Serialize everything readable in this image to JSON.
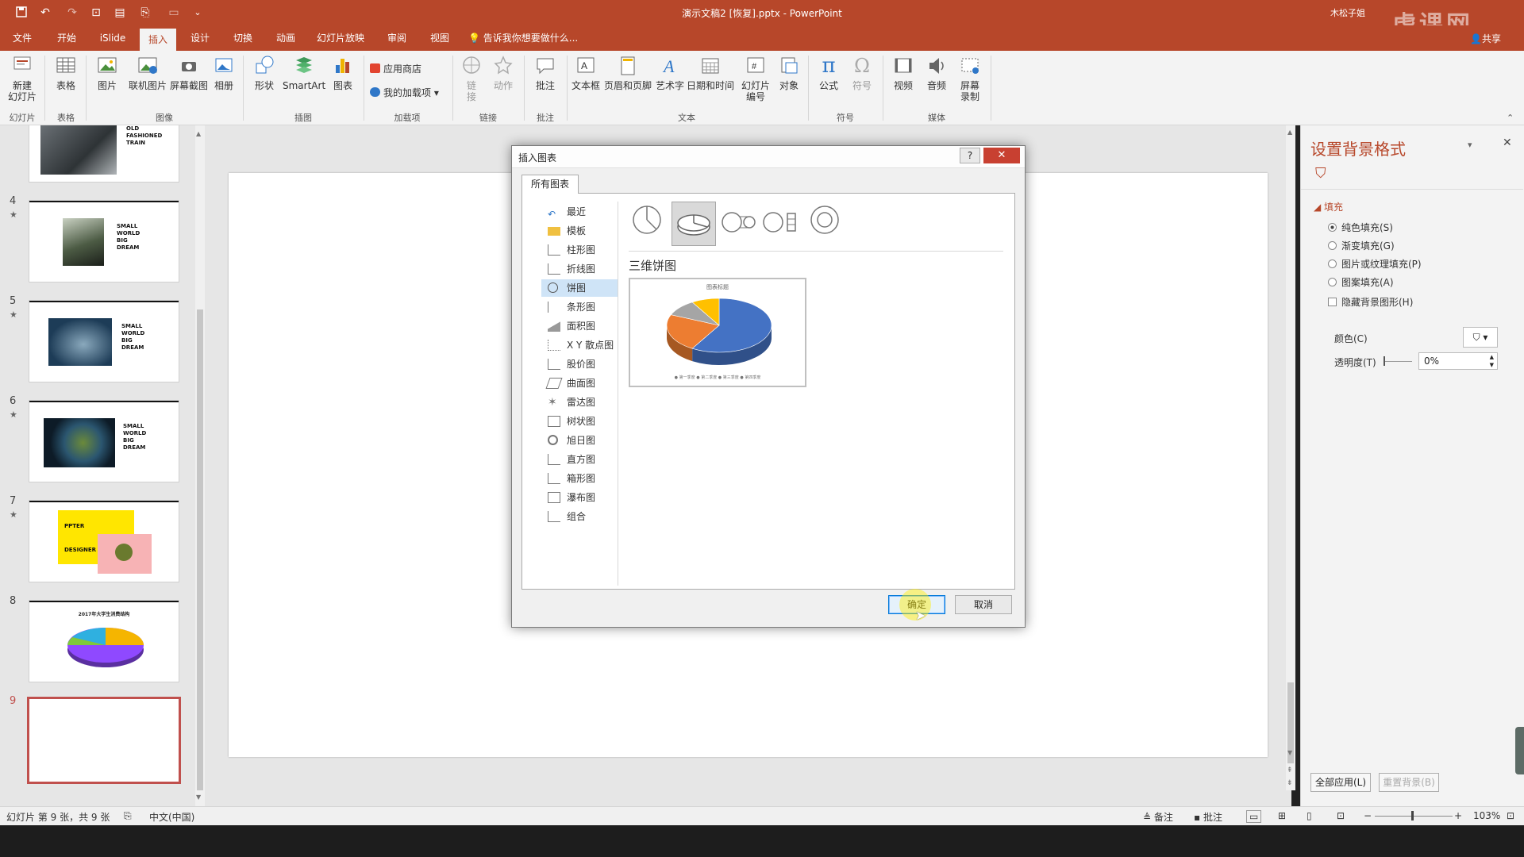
{
  "window": {
    "title": "演示文稿2 [恢复].pptx  -  PowerPoint",
    "user": "木松子姐",
    "share": "共享",
    "watermark": "虎课网"
  },
  "tabs": [
    "文件",
    "开始",
    "iSlide",
    "插入",
    "设计",
    "切换",
    "动画",
    "幻灯片放映",
    "审阅",
    "视图"
  ],
  "active_tab": "插入",
  "tell_me": "告诉我你想要做什么...",
  "ribbon": {
    "new_slide": [
      "新建",
      "幻灯片"
    ],
    "table": "表格",
    "picture": "图片",
    "online_picture": "联机图片",
    "screenshot": "屏幕截图",
    "album": "相册",
    "shapes": "形状",
    "smartart": "SmartArt",
    "chart": "图表",
    "store": "应用商店",
    "my_addins": "我的加载项",
    "link": [
      "链",
      "接"
    ],
    "action": "动作",
    "comment": "批注",
    "textbox": "文本框",
    "header_footer": "页眉和页脚",
    "wordart": "艺术字",
    "datetime": "日期和时间",
    "slide_number": [
      "幻灯片",
      "编号"
    ],
    "object": "对象",
    "equation": "公式",
    "symbol": "符号",
    "video": "视频",
    "audio": "音频",
    "screen_record": [
      "屏幕",
      "录制"
    ],
    "groups": {
      "slides": "幻灯片",
      "tables": "表格",
      "images": "图像",
      "illustrations": "插图",
      "addins": "加载项",
      "links": "链接",
      "comments": "批注",
      "text": "文本",
      "symbols": "符号",
      "media": "媒体"
    }
  },
  "thumbnails": {
    "items": [
      {
        "num": "4",
        "star": "★",
        "lines": [
          "SMALL",
          "WORLD",
          "BIG",
          "DREAM"
        ]
      },
      {
        "num": "5",
        "star": "★",
        "lines": [
          "SMALL",
          "WORLD",
          "BIG",
          "DREAM"
        ]
      },
      {
        "num": "6",
        "star": "★",
        "lines": [
          "SMALL",
          "WORLD",
          "BIG",
          "DREAM"
        ]
      },
      {
        "num": "7",
        "star": "★",
        "lines": [
          "PPTER",
          "DESIGNER"
        ]
      },
      {
        "num": "8",
        "title": "2017年大学生消费结构"
      },
      {
        "num": "9"
      }
    ],
    "top_lines": [
      "OLD",
      "FASHIONED",
      "TRAIN"
    ]
  },
  "dialog": {
    "title": "插入图表",
    "help": "?",
    "tab": "所有图表",
    "chart_types": [
      "最近",
      "模板",
      "柱形图",
      "折线图",
      "饼图",
      "条形图",
      "面积图",
      "X Y 散点图",
      "股价图",
      "曲面图",
      "雷达图",
      "树状图",
      "旭日图",
      "直方图",
      "箱形图",
      "瀑布图",
      "组合"
    ],
    "selected_type": "饼图",
    "selected_subtype": "三维饼图",
    "preview_title": "图表标题",
    "preview_legend": [
      "第一季度",
      "第二季度",
      "第三季度",
      "第四季度"
    ],
    "ok": "确定",
    "cancel": "取消"
  },
  "chart_data": {
    "type": "pie",
    "title": "图表标题",
    "categories": [
      "第一季度",
      "第二季度",
      "第三季度",
      "第四季度"
    ],
    "values": [
      8.2,
      3.2,
      1.4,
      1.2
    ],
    "colors": [
      "#4472c4",
      "#ed7d31",
      "#a5a5a5",
      "#ffc000"
    ]
  },
  "format_pane": {
    "title": "设置背景格式",
    "section": "填充",
    "options": [
      "纯色填充(S)",
      "渐变填充(G)",
      "图片或纹理填充(P)",
      "图案填充(A)"
    ],
    "hide_bg": "隐藏背景图形(H)",
    "color_label": "颜色(C)",
    "transparency_label": "透明度(T)",
    "transparency_value": "0%",
    "apply_all": "全部应用(L)",
    "reset_bg": "重置背景(B)"
  },
  "status": {
    "slide_info": "幻灯片 第 9 张，共 9 张",
    "language": "中文(中国)",
    "notes": "备注",
    "comments": "批注",
    "zoom": "103%"
  }
}
